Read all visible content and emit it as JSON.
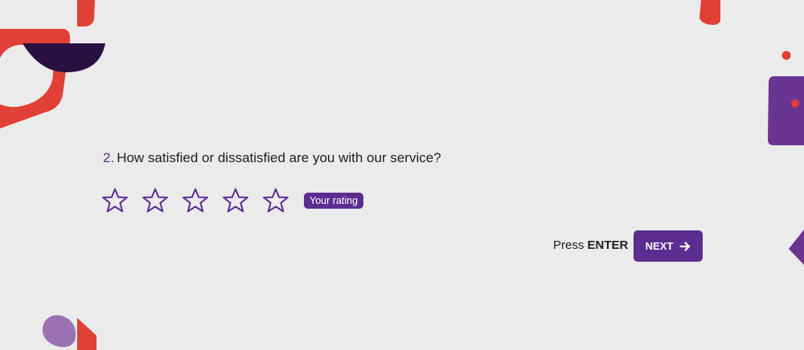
{
  "question": {
    "number": "2.",
    "text": "How satisfied or dissatisfied are you with our service?"
  },
  "rating": {
    "max_stars": 5,
    "selected_stars": 0,
    "badge_label": "Your rating"
  },
  "footer": {
    "press_prefix": "Press",
    "press_key": "ENTER",
    "next_label": "NEXT"
  },
  "colors": {
    "accent": "#5b2d91",
    "background": "#ebebeb",
    "decor_red": "#e04035",
    "decor_dark": "#2a1040",
    "decor_lavender": "#9b72b3"
  },
  "icons": {
    "rating": "star-outline-icon",
    "next": "arrow-right-icon"
  }
}
